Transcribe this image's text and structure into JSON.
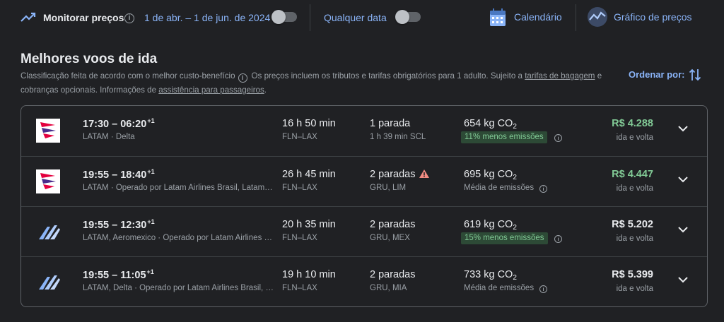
{
  "topbar": {
    "monitor_label": "Monitorar preços",
    "date_range": "1 de abr. – 1 de jun. de 2024",
    "any_date_label": "Qualquer data",
    "calendar_label": "Calendário",
    "price_graph_label": "Gráfico de preços",
    "info_icon": "info-icon",
    "accent_color": "#8ab4f8"
  },
  "section": {
    "title": "Melhores voos de ida",
    "ranking_note": "Classificação feita de acordo com o melhor custo-benefício",
    "price_note": "Os preços incluem os tributos e tarifas obrigatórios para 1 adulto. Sujeito a ",
    "baggage_link": "tarifas de bagagem",
    "optional_charges": " e cobranças opcionais. Informações de ",
    "assistance_link": "assistência para passageiros",
    "period": ".",
    "sort_label": "Ordenar por:"
  },
  "flights": [
    {
      "logo": "latam-logo",
      "departure": "17:30",
      "arrival": "06:20",
      "day_offset": "+1",
      "airline": "LATAM · Delta",
      "duration": "16 h 50 min",
      "route": "FLN–LAX",
      "stops": "1 parada",
      "stops_warning": false,
      "layover": "1 h 39 min SCL",
      "co2_value": "654 kg CO",
      "co2_sub": "2",
      "emissions": "11% menos emissões",
      "emissions_badge": true,
      "price": "R$ 4.288",
      "price_color": "#81c995",
      "trip_type": "ida e volta"
    },
    {
      "logo": "latam-logo",
      "departure": "19:55",
      "arrival": "18:40",
      "day_offset": "+1",
      "airline": "LATAM · Operado por Latam Airlines Brasil, Latam Airlines Chile",
      "duration": "26 h 45 min",
      "route": "FLN–LAX",
      "stops": "2 paradas",
      "stops_warning": true,
      "layover": "GRU, LIM",
      "co2_value": "695 kg CO",
      "co2_sub": "2",
      "emissions": "Média de emissões",
      "emissions_badge": false,
      "price": "R$ 4.447",
      "price_color": "#81c995",
      "trip_type": "ida e volta"
    },
    {
      "logo": "multi-airline-logo",
      "departure": "19:55",
      "arrival": "12:30",
      "day_offset": "+1",
      "airline": "LATAM, Aeromexico · Operado por Latam Airlines Brasil",
      "duration": "20 h 35 min",
      "route": "FLN–LAX",
      "stops": "2 paradas",
      "stops_warning": false,
      "layover": "GRU, MEX",
      "co2_value": "619 kg CO",
      "co2_sub": "2",
      "emissions": "15% menos emissões",
      "emissions_badge": true,
      "price": "R$ 5.202",
      "price_color": "#e8eaed",
      "trip_type": "ida e volta"
    },
    {
      "logo": "multi-airline-logo",
      "departure": "19:55",
      "arrival": "11:05",
      "day_offset": "+1",
      "airline": "LATAM, Delta · Operado por Latam Airlines Brasil, Delta",
      "duration": "19 h 10 min",
      "route": "FLN–LAX",
      "stops": "2 paradas",
      "stops_warning": false,
      "layover": "GRU, MIA",
      "co2_value": "733 kg CO",
      "co2_sub": "2",
      "emissions": "Média de emissões",
      "emissions_badge": false,
      "price": "R$ 5.399",
      "price_color": "#e8eaed",
      "trip_type": "ida e volta"
    }
  ]
}
